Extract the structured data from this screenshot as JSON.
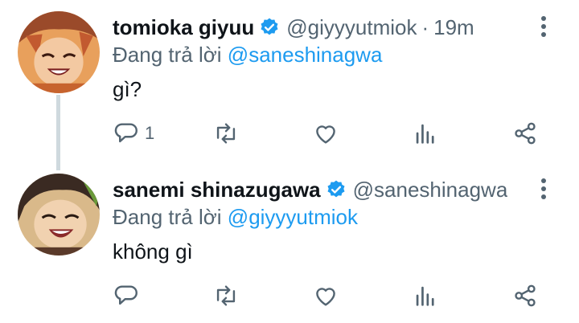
{
  "colors": {
    "accent": "#1d9bf0",
    "secondary_text": "#536471",
    "primary_text": "#0f1419",
    "thread_line": "#cfd9de"
  },
  "tweets": [
    {
      "author_name": "tomioka giyuu",
      "handle": "@giyyyutmiok",
      "separator": "·",
      "time": "19m",
      "reply_prefix": "Đang trả lời",
      "reply_to": "@saneshinagwa",
      "text": "gì?",
      "reply_count": "1",
      "icons": [
        "verified-badge-icon",
        "more-vertical-icon",
        "reply-icon",
        "retweet-icon",
        "like-icon",
        "views-icon",
        "share-icon"
      ]
    },
    {
      "author_name": "sanemi shinazugawa",
      "handle": "@saneshinagwa",
      "reply_prefix": "Đang trả lời",
      "reply_to": "@giyyyutmiok",
      "text": "không gì",
      "icons": [
        "verified-badge-icon",
        "more-vertical-icon",
        "reply-icon",
        "retweet-icon",
        "like-icon",
        "views-icon",
        "share-icon"
      ]
    }
  ]
}
